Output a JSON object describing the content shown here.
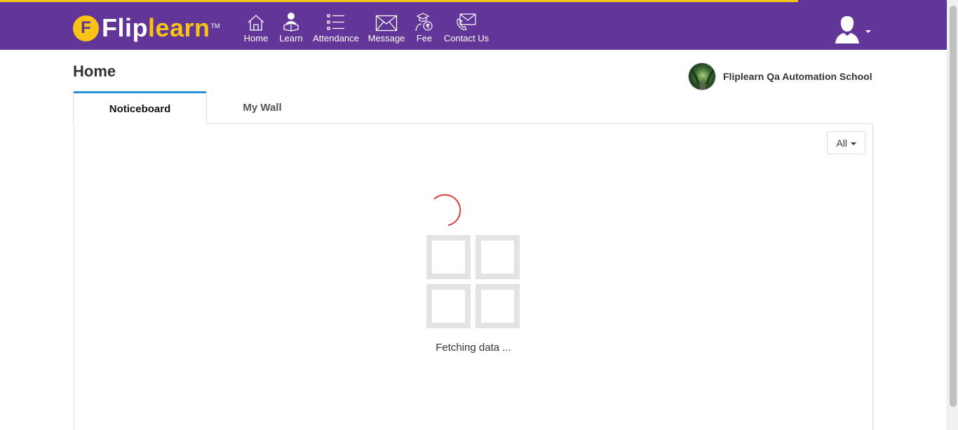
{
  "brand": {
    "logo_letter": "F",
    "logo_flip": "Flip",
    "logo_learn": "learn",
    "logo_tm": "TM",
    "accent": "#623598",
    "yellow": "#f9c316"
  },
  "nav": {
    "items": [
      {
        "label": "Home",
        "icon": "home-icon"
      },
      {
        "label": "Learn",
        "icon": "learn-icon"
      },
      {
        "label": "Attendance",
        "icon": "attendance-list-icon"
      },
      {
        "label": "Message",
        "icon": "envelope-icon"
      },
      {
        "label": "Fee",
        "icon": "fee-rupee-icon"
      },
      {
        "label": "Contact Us",
        "icon": "phone-envelope-icon"
      }
    ]
  },
  "user": {
    "icon": "user-avatar-icon",
    "menu_icon": "caret-down-icon"
  },
  "page": {
    "title": "Home"
  },
  "school": {
    "name": "Fliplearn Qa Automation School"
  },
  "tabs": [
    {
      "label": "Noticeboard",
      "active": true
    },
    {
      "label": "My Wall",
      "active": false
    }
  ],
  "filter": {
    "selected": "All"
  },
  "loader": {
    "text": "Fetching data ..."
  },
  "colors": {
    "tab_active_border": "#2b8fd8",
    "spinner": "#e03a3a"
  }
}
